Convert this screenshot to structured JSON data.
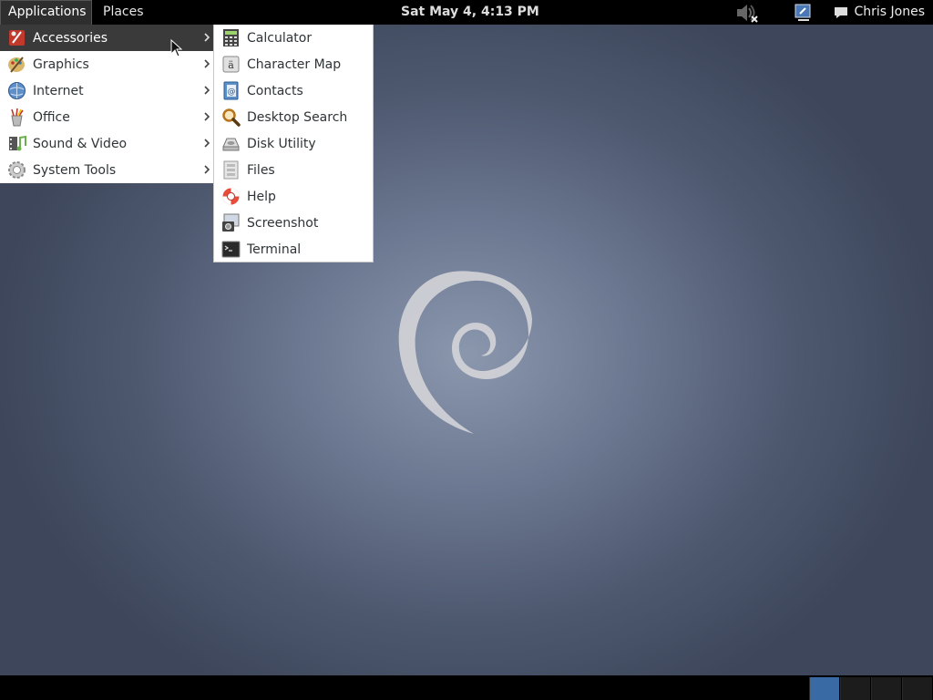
{
  "topbar": {
    "applications_label": "Applications",
    "places_label": "Places",
    "clock": "Sat May  4,  4:13 PM",
    "user_name": "Chris Jones",
    "volume_icon": "volume-muted-icon",
    "network_icon": "network-icon",
    "chat_icon": "chat-bubble-icon"
  },
  "menu": {
    "categories": [
      {
        "label": "Accessories",
        "icon": "accessories-icon"
      },
      {
        "label": "Graphics",
        "icon": "graphics-icon"
      },
      {
        "label": "Internet",
        "icon": "internet-icon"
      },
      {
        "label": "Office",
        "icon": "office-icon"
      },
      {
        "label": "Sound & Video",
        "icon": "sound-video-icon"
      },
      {
        "label": "System Tools",
        "icon": "system-tools-icon"
      }
    ],
    "active_category": "Accessories"
  },
  "submenu": {
    "items": [
      {
        "label": "Calculator",
        "icon": "calculator-icon"
      },
      {
        "label": "Character Map",
        "icon": "character-map-icon"
      },
      {
        "label": "Contacts",
        "icon": "contacts-icon"
      },
      {
        "label": "Desktop Search",
        "icon": "search-icon"
      },
      {
        "label": "Disk Utility",
        "icon": "disk-utility-icon"
      },
      {
        "label": "Files",
        "icon": "files-icon"
      },
      {
        "label": "Help",
        "icon": "help-icon"
      },
      {
        "label": "Screenshot",
        "icon": "screenshot-icon"
      },
      {
        "label": "Terminal",
        "icon": "terminal-icon"
      }
    ]
  },
  "colors": {
    "panel": "#000000",
    "menu_hover": "#3a3a3a",
    "active_workspace": "#3a6aa4",
    "desktop": "#6c7891"
  }
}
